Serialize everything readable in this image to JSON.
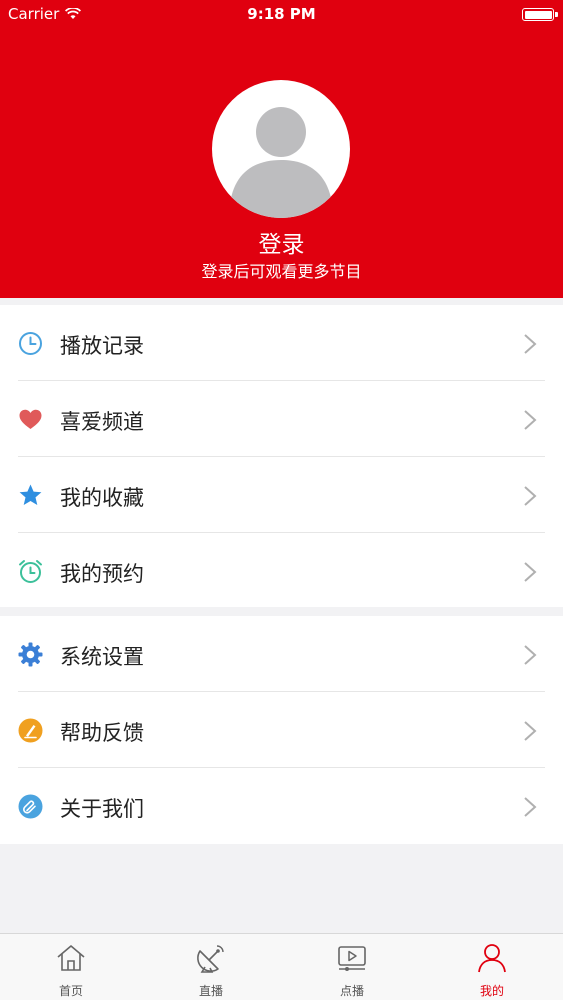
{
  "status_bar": {
    "carrier": "Carrier",
    "time": "9:18 PM"
  },
  "profile": {
    "login_title": "登录",
    "login_subtitle": "登录后可观看更多节目"
  },
  "menu_group_1": [
    {
      "label": "播放记录",
      "icon": "clock-icon",
      "color": "#4aa3df"
    },
    {
      "label": "喜爱频道",
      "icon": "heart-icon",
      "color": "#e05a5a"
    },
    {
      "label": "我的收藏",
      "icon": "star-icon",
      "color": "#2f8fe0"
    },
    {
      "label": "我的预约",
      "icon": "alarm-clock-icon",
      "color": "#3cc09a"
    }
  ],
  "menu_group_2": [
    {
      "label": "系统设置",
      "icon": "gear-icon",
      "color": "#3b7fd6"
    },
    {
      "label": "帮助反馈",
      "icon": "pencil-icon",
      "color": "#f0a020"
    },
    {
      "label": "关于我们",
      "icon": "paperclip-icon",
      "color": "#4aa3df"
    }
  ],
  "tab_bar": [
    {
      "label": "首页",
      "icon": "home-icon",
      "active": false
    },
    {
      "label": "直播",
      "icon": "satellite-dish-icon",
      "active": false
    },
    {
      "label": "点播",
      "icon": "video-play-icon",
      "active": false
    },
    {
      "label": "我的",
      "icon": "user-icon",
      "active": true
    }
  ],
  "colors": {
    "brand_red": "#e0000f",
    "background": "#f2f2f4",
    "chevron": "#b0b0b0"
  }
}
